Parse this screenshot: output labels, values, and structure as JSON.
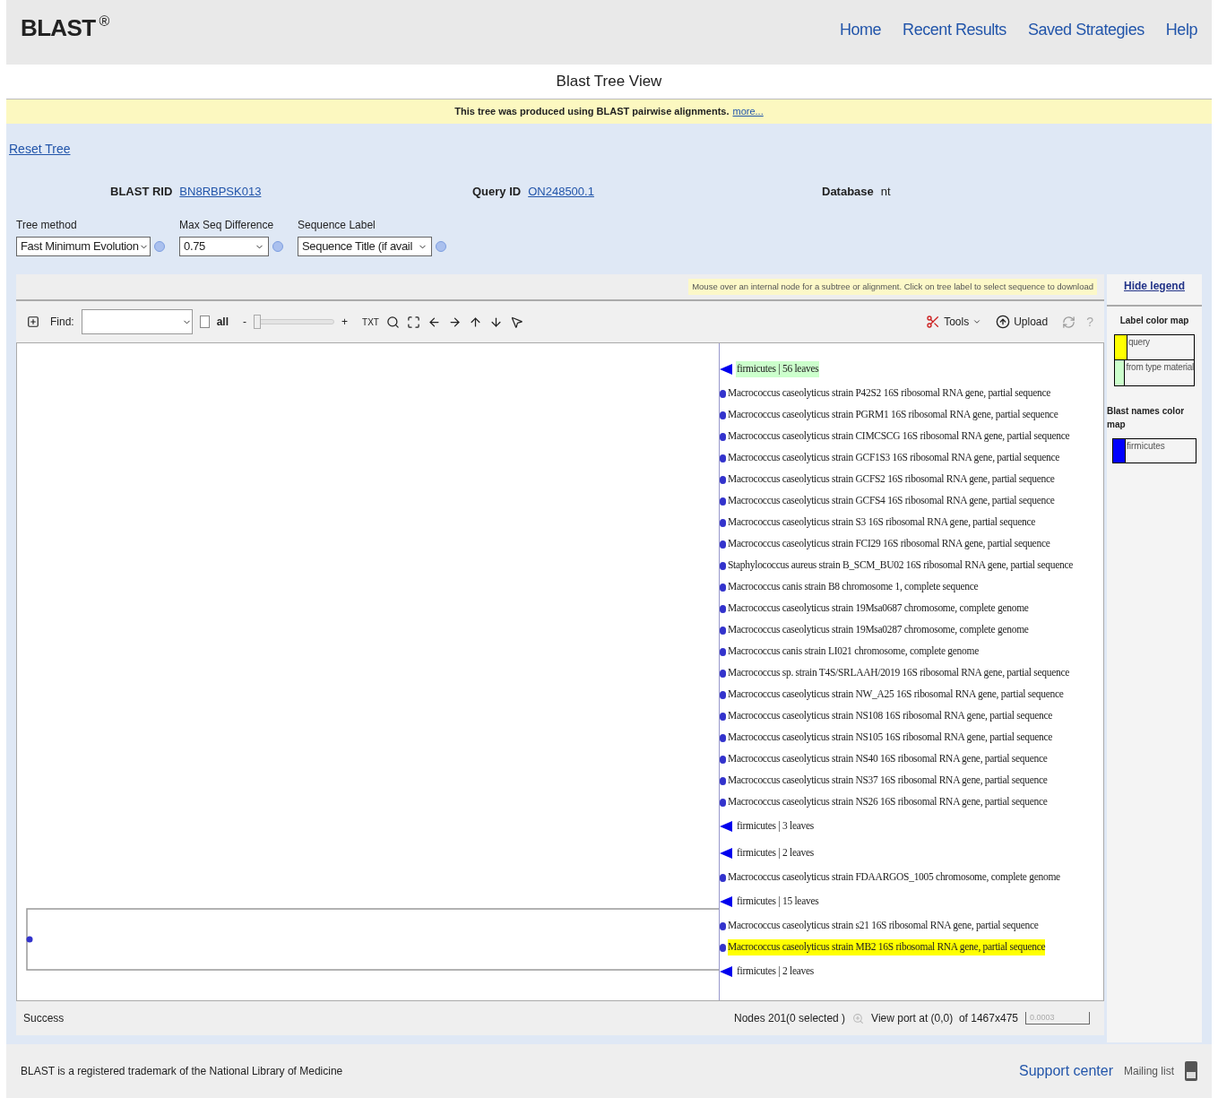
{
  "header": {
    "logo": "BLAST",
    "logo_mark": "®",
    "nav": [
      "Home",
      "Recent Results",
      "Saved Strategies",
      "Help"
    ]
  },
  "page_title": "Blast Tree View",
  "banner": {
    "text": "This tree was produced using BLAST pairwise alignments.",
    "link": "more..."
  },
  "reset_link": "Reset Tree",
  "info": [
    {
      "label": "BLAST RID",
      "value": "BN8RBPSK013",
      "link": true
    },
    {
      "label": "Query ID",
      "value": "ON248500.1",
      "link": true
    },
    {
      "label": "Database",
      "value": "nt",
      "link": false
    }
  ],
  "options": [
    {
      "label": "Tree method",
      "value": "Fast Minimum Evolution"
    },
    {
      "label": "Max Seq Difference",
      "value": "0.75"
    },
    {
      "label": "Sequence Label",
      "value": "Sequence Title (if avail"
    }
  ],
  "hint": "Mouse over an internal node for a subtree or alignment. Click on tree label to select sequence to download",
  "toolbar": {
    "find_label": "Find:",
    "all_label": "all",
    "all_checked": false,
    "minus": "-",
    "plus": "+",
    "level": 0,
    "txt": "TXT",
    "tools": "Tools",
    "upload": "Upload",
    "help": "?"
  },
  "tree": [
    {
      "kind": "group",
      "label": "firmicutes | 56 leaves",
      "color": "#ccffcc"
    },
    {
      "kind": "leaf",
      "label": "Macrococcus caseolyticus strain P42S2 16S ribosomal RNA gene, partial sequence"
    },
    {
      "kind": "leaf",
      "label": "Macrococcus caseolyticus strain PGRM1 16S ribosomal RNA gene, partial sequence"
    },
    {
      "kind": "leaf",
      "label": "Macrococcus caseolyticus strain CIMCSCG 16S ribosomal RNA gene, partial sequence"
    },
    {
      "kind": "leaf",
      "label": "Macrococcus caseolyticus strain GCF1S3 16S ribosomal RNA gene, partial sequence"
    },
    {
      "kind": "leaf",
      "label": "Macrococcus caseolyticus strain GCFS2 16S ribosomal RNA gene, partial sequence"
    },
    {
      "kind": "leaf",
      "label": "Macrococcus caseolyticus strain GCFS4 16S ribosomal RNA gene, partial sequence"
    },
    {
      "kind": "leaf",
      "label": "Macrococcus caseolyticus strain S3 16S ribosomal RNA gene, partial sequence"
    },
    {
      "kind": "leaf",
      "label": "Macrococcus caseolyticus strain FCI29 16S ribosomal RNA gene, partial sequence"
    },
    {
      "kind": "leaf",
      "label": "Staphylococcus aureus strain B_SCM_BU02 16S ribosomal RNA gene, partial sequence"
    },
    {
      "kind": "leaf",
      "label": "Macrococcus canis strain B8 chromosome 1, complete sequence"
    },
    {
      "kind": "leaf",
      "label": "Macrococcus caseolyticus strain 19Msa0687 chromosome, complete genome"
    },
    {
      "kind": "leaf",
      "label": "Macrococcus caseolyticus strain 19Msa0287 chromosome, complete genome"
    },
    {
      "kind": "leaf",
      "label": "Macrococcus canis strain LI021 chromosome, complete genome"
    },
    {
      "kind": "leaf",
      "label": "Macrococcus sp. strain T4S/SRLAAH/2019 16S ribosomal RNA gene, partial sequence"
    },
    {
      "kind": "leaf",
      "label": "Macrococcus caseolyticus strain NW_A25 16S ribosomal RNA gene, partial sequence"
    },
    {
      "kind": "leaf",
      "label": "Macrococcus caseolyticus strain NS108 16S ribosomal RNA gene, partial sequence"
    },
    {
      "kind": "leaf",
      "label": "Macrococcus caseolyticus strain NS105 16S ribosomal RNA gene, partial sequence"
    },
    {
      "kind": "leaf",
      "label": "Macrococcus caseolyticus strain NS40 16S ribosomal RNA gene, partial sequence"
    },
    {
      "kind": "leaf",
      "label": "Macrococcus caseolyticus strain NS37 16S ribosomal RNA gene, partial sequence"
    },
    {
      "kind": "leaf",
      "label": "Macrococcus caseolyticus strain NS26 16S ribosomal RNA gene, partial sequence"
    },
    {
      "kind": "group",
      "label": "firmicutes | 3 leaves"
    },
    {
      "kind": "group",
      "label": "firmicutes | 2 leaves"
    },
    {
      "kind": "leaf",
      "label": "Macrococcus caseolyticus strain FDAARGOS_1005 chromosome, complete genome"
    },
    {
      "kind": "group",
      "label": "firmicutes | 15 leaves"
    },
    {
      "kind": "leaf",
      "label": "Macrococcus caseolyticus strain s21 16S ribosomal RNA gene, partial sequence"
    },
    {
      "kind": "leaf",
      "label": "Macrococcus caseolyticus strain MB2 16S ribosomal RNA gene, partial sequence",
      "color": "#ffff00"
    },
    {
      "kind": "group",
      "label": "firmicutes | 2 leaves"
    }
  ],
  "legend": {
    "hide": "Hide legend",
    "label_title": "Label color map",
    "label_items": [
      {
        "label": "query",
        "color": "#ffff00"
      },
      {
        "label": "from type material",
        "color": "#ccffcc"
      }
    ],
    "names_title": "Blast names color map",
    "names_items": [
      {
        "label": "firmicutes",
        "color": "#0000ff"
      }
    ]
  },
  "status": {
    "message": "Success",
    "nodes": "Nodes 201(0 selected )",
    "viewport": "View port at (0,0)  of 1467x475",
    "scale": "0.0003"
  },
  "footer": {
    "text": "BLAST is a registered trademark of the National Library of Medicine",
    "support": "Support center",
    "mailing": "Mailing list"
  }
}
